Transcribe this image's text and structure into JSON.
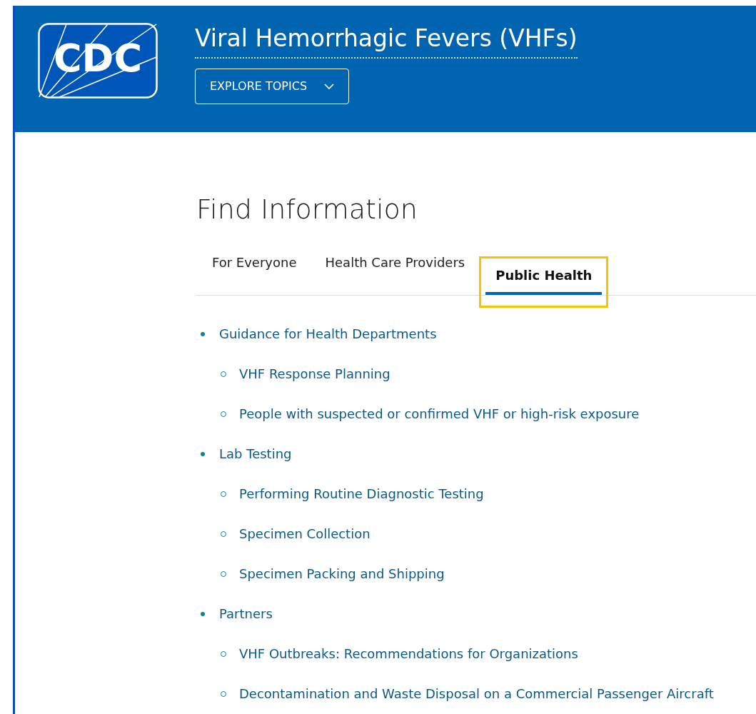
{
  "header": {
    "logo_text": "CDC",
    "title": "Viral Hemorrhagic Fevers (VHFs)",
    "explore_button": "EXPLORE TOPICS"
  },
  "section": {
    "heading": "Find Information",
    "tabs": [
      {
        "label": "For Everyone",
        "selected": false,
        "highlighted": false
      },
      {
        "label": "Health Care Providers",
        "selected": false,
        "highlighted": false
      },
      {
        "label": "Public Health",
        "selected": true,
        "highlighted": true
      }
    ],
    "links": [
      {
        "label": "Guidance for Health Departments",
        "children": [
          {
            "label": "VHF Response Planning"
          },
          {
            "label": "People with suspected or confirmed VHF or high-risk exposure"
          }
        ]
      },
      {
        "label": "Lab Testing",
        "children": [
          {
            "label": "Performing Routine Diagnostic Testing"
          },
          {
            "label": "Specimen Collection"
          },
          {
            "label": "Specimen Packing and Shipping"
          }
        ]
      },
      {
        "label": "Partners",
        "children": [
          {
            "label": "VHF Outbreaks: Recommendations for Organizations"
          },
          {
            "label": "Decontamination and Waste Disposal on a Commercial Passenger Aircraft"
          }
        ]
      }
    ]
  }
}
